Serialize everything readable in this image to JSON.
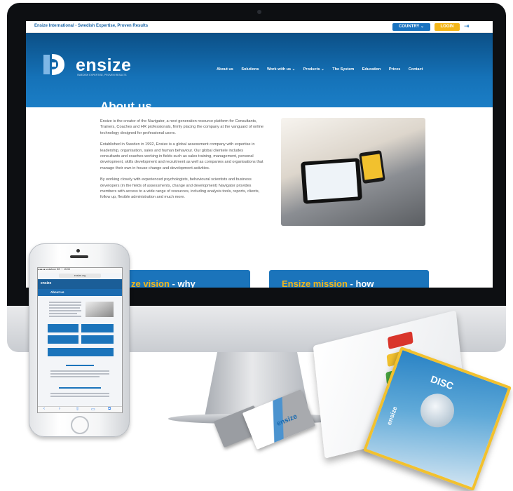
{
  "website": {
    "topbar_text": "Ensize International - Swedish Expertise, Proven Results",
    "country_label": "COUNTRY ⌄",
    "login_label": "LOGIN",
    "logo_text": "ensize",
    "logo_subtitle": "SWEDISH EXPERTISE, PROVEN RESULTS",
    "nav": [
      "About us",
      "Solutions",
      "Work with us ⌄",
      "Products ⌄",
      "The System",
      "Education",
      "Prices",
      "Contact"
    ],
    "page_title": "About us",
    "paragraphs": [
      "Ensize is the creator of the Navigator, a next generation resource platform for Consultants, Trainers, Coaches and HR professionals, firmly placing the company at the vanguard of online technology designed for professional users.",
      "Established in Sweden in 1992, Ensize is a global assessment company with expertise in leadership, organisation, sales and human behaviour. Our global clientele includes consultants and coaches working in fields such as sales training, management, personal development, skills development and recruitment as well as companies and organisations that manage their own in-house change and development activities.",
      "By working closely with experienced psychologists, behavioural scientists and business developers (in the fields of assessments, change and development) Navigator provides members with access to a wide range of resources, including analysis tools, reports, clients, follow up, flexible administration and much more."
    ],
    "card_vision": {
      "highlight": "ze vision",
      "rest": " - why"
    },
    "card_mission": {
      "highlight": "Ensize mission",
      "rest": " - how"
    }
  },
  "mobile": {
    "status": "●●●●● vodafone DE   ⌔    15:33",
    "url": "ensize.org",
    "logo": "ensize",
    "title": "About us"
  },
  "brochure": {
    "title": "DISC",
    "brand": "ensize"
  },
  "business_card": {
    "brand": "ensize"
  },
  "colors": {
    "brand_blue": "#1b74bb",
    "accent_yellow": "#f4b619",
    "header_dark": "#0b4f86"
  }
}
